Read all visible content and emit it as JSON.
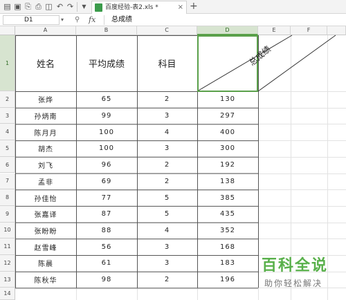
{
  "toolbar": {
    "icons": [
      "document-icon",
      "save-icon",
      "export-icon",
      "print-icon",
      "preview-icon",
      "undo-icon",
      "redo-icon",
      "dropdown-icon"
    ],
    "tab": {
      "label": "百度经验-表2.xls *",
      "close": "×"
    },
    "new_tab": "+"
  },
  "formula_bar": {
    "cell_ref": "D1",
    "fx": "fx",
    "content": "总成绩"
  },
  "sheet": {
    "columns": [
      "A",
      "B",
      "C",
      "D",
      "E",
      "F"
    ],
    "rows": [
      "1",
      "2",
      "3",
      "4",
      "5",
      "6",
      "7",
      "8",
      "9",
      "10",
      "11",
      "12",
      "13",
      "14",
      "15"
    ],
    "header": {
      "name": "姓名",
      "avg": "平均成绩",
      "subject": "科目",
      "total": "总成绩"
    },
    "data": [
      {
        "name": "张烨",
        "avg": "65",
        "subject": "2",
        "total": "130"
      },
      {
        "name": "孙炳南",
        "avg": "99",
        "subject": "3",
        "total": "297"
      },
      {
        "name": "陈月月",
        "avg": "100",
        "subject": "4",
        "total": "400"
      },
      {
        "name": "胡杰",
        "avg": "100",
        "subject": "3",
        "total": "300"
      },
      {
        "name": "刘飞",
        "avg": "96",
        "subject": "2",
        "total": "192"
      },
      {
        "name": "孟非",
        "avg": "69",
        "subject": "2",
        "total": "138"
      },
      {
        "name": "孙佳怡",
        "avg": "77",
        "subject": "5",
        "total": "385"
      },
      {
        "name": "张嘉译",
        "avg": "87",
        "subject": "5",
        "total": "435"
      },
      {
        "name": "张盼盼",
        "avg": "88",
        "subject": "4",
        "total": "352"
      },
      {
        "name": "赵雪峰",
        "avg": "56",
        "subject": "3",
        "total": "168"
      },
      {
        "name": "陈晨",
        "avg": "61",
        "subject": "3",
        "total": "183"
      },
      {
        "name": "陈秋华",
        "avg": "98",
        "subject": "2",
        "total": "196"
      }
    ],
    "selected_cell": "D1"
  },
  "watermark": {
    "title": "百科全说",
    "subtitle": "助你轻松解决"
  },
  "colors": {
    "accent": "#58b04a",
    "selection": "#5aa04a"
  }
}
